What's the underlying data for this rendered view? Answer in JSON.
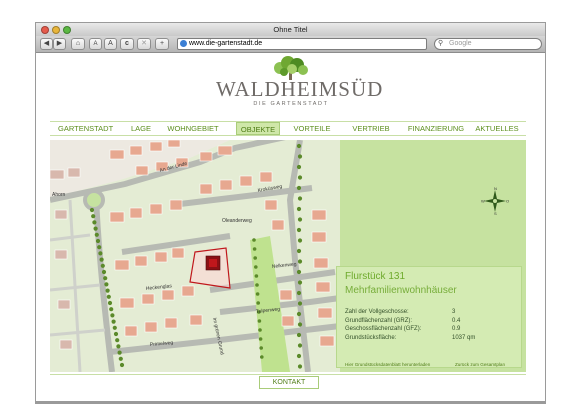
{
  "window": {
    "title": "Ohne Titel"
  },
  "toolbar": {
    "back": "◀",
    "forward": "▶",
    "home": "⌂",
    "font_small": "A",
    "font_large": "A",
    "reload": "c",
    "stop": "✕",
    "add": "+",
    "url": "www.die-gartenstadt.de",
    "search_placeholder": "Google"
  },
  "logo": {
    "brand": "WALDHEIMSÜD",
    "tagline": "DIE GARTENSTADT"
  },
  "nav": {
    "items": [
      {
        "label": "GARTENSTADT"
      },
      {
        "label": "LAGE"
      },
      {
        "label": "WOHNGEBIET"
      },
      {
        "label": "OBJEKTE"
      },
      {
        "label": "VORTEILE"
      },
      {
        "label": "VERTRIEB"
      },
      {
        "label": "FINANZIERUNG"
      },
      {
        "label": "AKTUELLES"
      }
    ],
    "active": "OBJEKTE"
  },
  "map": {
    "street_labels": [
      "An der Linde",
      "Kroküsweg",
      "Oleanderweg",
      "Nelkenweg",
      "Heckenglas",
      "Tulpenweg",
      "Primelweg",
      "Im grünen Grund",
      "Ahorn"
    ],
    "compass": {
      "n": "N",
      "s": "S",
      "w": "W",
      "e": "O"
    }
  },
  "info": {
    "title": "Flurstück 131",
    "subtitle": "Mehrfamilienwohnhäuser",
    "props": [
      {
        "label": "Zahl der Vollgeschosse:",
        "value": "3"
      },
      {
        "label": "Grundflächenzahl (GRZ):",
        "value": "0.4"
      },
      {
        "label": "Geschossflächenzahl (GFZ):",
        "value": "0.9"
      },
      {
        "label": "Grundstücksfläche:",
        "value": "1037 qm"
      }
    ],
    "link_download": "Hier Grundstücksdatenblatt herunterladen",
    "link_back": "Zurück zum Gesamtplan"
  },
  "footer": {
    "contact": "KONTAKT"
  },
  "colors": {
    "accent": "#5c8f1e",
    "nav_active": "#cfe7a8",
    "map_bg": "#c6e2a0",
    "plot_marker": "#c0171c"
  }
}
